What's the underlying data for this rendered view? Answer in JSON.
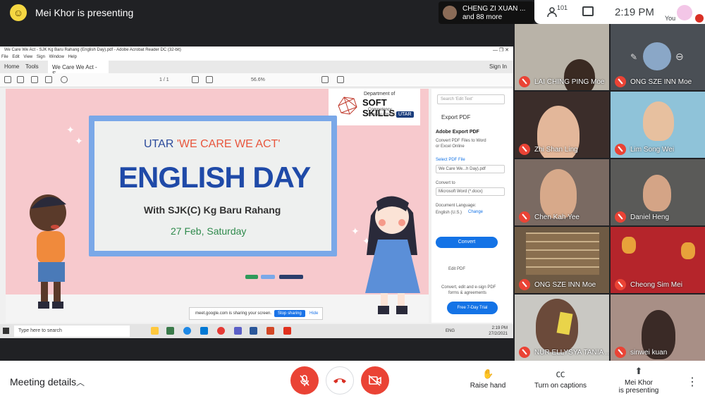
{
  "top": {
    "presenting_text": "Mei Khor is presenting",
    "joiner": {
      "line1": "CHENG ZI XUAN ...",
      "line2": "and 88 more"
    },
    "participants_count": "101",
    "time": "2:19  PM",
    "you_label": "You"
  },
  "share": {
    "window_title": "We Care We Act - SJK Kg Baru Rahang (English Day).pdf - Adobe Acrobat Reader DC (32-bit)",
    "window_controls": "—   ❐   ✕",
    "menu": "File Edit View Sign Window Help",
    "tabs": {
      "home": "Home",
      "tools": "Tools",
      "doc": "We Care We Act - S...",
      "sign_in": "Sign In"
    },
    "toolbar": {
      "page": "1   /  1",
      "zoom": "56.6%"
    },
    "slide": {
      "logo_line1": "Department of",
      "logo_line2": "SOFT SKILLS",
      "logo_line3": "Competency",
      "logo_line4": "SUNGAI LONG CAMPUS",
      "logo_badge": "UTAR",
      "subtitle_prefix": "UTAR ",
      "subtitle_accent": "'WE CARE WE ACT'",
      "title": "ENGLISH DAY",
      "line1": "With SJK(C) Kg Baru Rahang",
      "line2": "27 Feb, Saturday"
    },
    "right_pane": {
      "search": "Search 'Edit Text'",
      "export_head": "Export PDF",
      "adobe_export": "Adobe Export PDF",
      "convert_desc1": "Convert PDF Files to Word",
      "convert_desc2": "or Excel Online",
      "select_pdf": "Select PDF File",
      "file_value": "We Care We...h Day).pdf",
      "convert_to": "Convert to",
      "format_value": "Microsoft Word (*.docx)",
      "doc_lang": "Document Language:",
      "lang_value": "English (U.S.)",
      "change": "Change",
      "convert_btn": "Convert",
      "edit_pdf": "Edit PDF",
      "promo1": "Convert, edit and e-sign PDF",
      "promo2": "forms & agreements",
      "trial_btn": "Free 7-Day Trial"
    },
    "share_notice": {
      "text": "meet.google.com is sharing your screen.",
      "stop": "Stop sharing",
      "hide": "Hide"
    },
    "taskbar": {
      "search": "Type here to search",
      "lang": "ENG",
      "time": "2:19 PM",
      "date": "27/2/2021"
    }
  },
  "tiles": [
    {
      "name": "LAI CHING PING Moe",
      "bg": "#b9b3a8"
    },
    {
      "name": "ONG SZE INN Moe",
      "bg": "#4a4f55"
    },
    {
      "name": "Zhi Shan Ling",
      "bg": "#3b2d2a"
    },
    {
      "name": "Lim Song Wei",
      "bg": "#8fc3d9"
    },
    {
      "name": "Chen Kah Yee",
      "bg": "#7a6a62"
    },
    {
      "name": "Daniel Heng",
      "bg": "#5a5a58"
    },
    {
      "name": "ONG SZE INN Moe",
      "bg": "#6e5a44"
    },
    {
      "name": "Cheong Sim Mei",
      "bg": "#b5252b"
    },
    {
      "name": "NUR ELLYSYA TANIA ...",
      "bg": "#c9c8c3"
    },
    {
      "name": "sinwei kuan",
      "bg": "#a88f86"
    }
  ],
  "bottom": {
    "meeting_details": "Meeting details",
    "raise_hand": "Raise hand",
    "captions": "Turn on captions",
    "presenting_line1": "Mei Khor",
    "presenting_line2": "is presenting"
  },
  "colors": {
    "red": "#ea4335",
    "meet_bg": "#202124",
    "slide_pink": "#f7c9cd",
    "board_blue": "#7aa8e8"
  }
}
